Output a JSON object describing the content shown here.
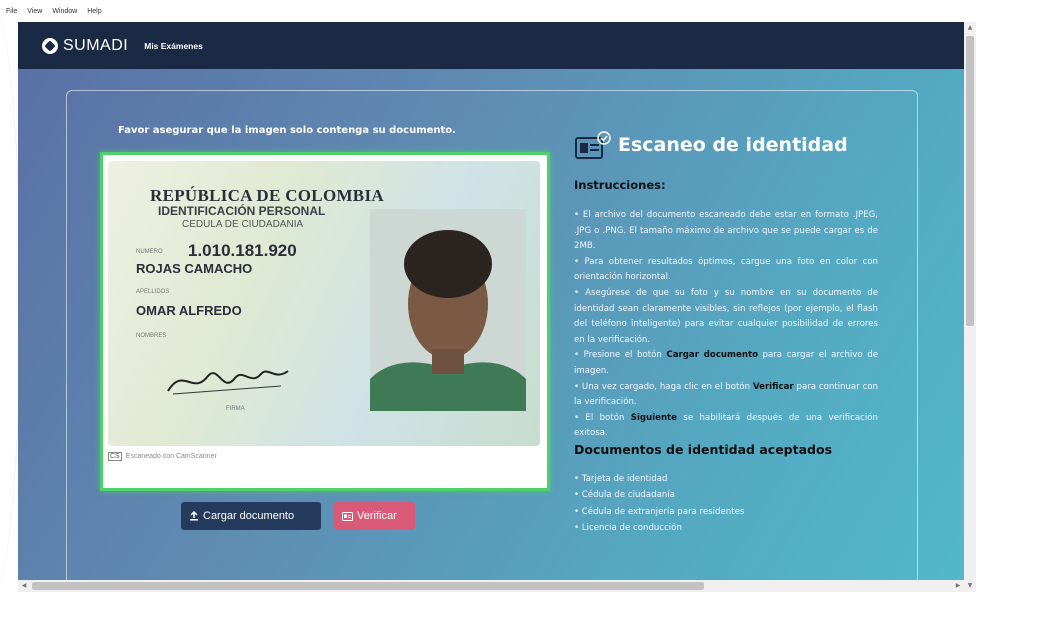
{
  "menubar": {
    "items": [
      "File",
      "View",
      "Window",
      "Help"
    ]
  },
  "nav": {
    "brand": "SUMADI",
    "link": "Mis Exámenes"
  },
  "warning": "Favor asegurar que la imagen solo contenga su documento.",
  "document": {
    "country": "REPÚBLICA DE COLOMBIA",
    "type": "IDENTIFICACIÓN PERSONAL",
    "subtype": "CEDULA DE CIUDADANIA",
    "number_label": "NUMERO",
    "number": "1.010.181.920",
    "surname": "ROJAS CAMACHO",
    "surname_label": "APELLIDOS",
    "given_names": "OMAR ALFREDO",
    "names_label": "NOMBRES",
    "signature_label": "FIRMA",
    "scanner_badge": "CS",
    "scanner_text": "Escaneado con CamScanner"
  },
  "buttons": {
    "upload": "Cargar documento",
    "verify": "Verificar"
  },
  "right": {
    "title": "Escaneo de identidad",
    "instructions_heading": "Instrucciones:",
    "instructions": [
      {
        "text": "• El archivo del documento escaneado debe estar en formato .JPEG, .JPG o .PNG. El tamaño máximo de archivo que se puede cargar es de 2MB."
      },
      {
        "text": "• Para obtener resultados óptimos, cargue una foto en color con orientación horizontal."
      },
      {
        "text": "• Asegúrese de que su foto y su nombre en su documento de identidad sean claramente visibles, sin reflejos (por ejemplo, el flash del teléfono inteligente) para evitar cualquier posibilidad de errores en la verificación."
      },
      {
        "pre": "• Presione el botón ",
        "bold": "Cargar documento",
        "post": " para cargar el archivo de imagen."
      },
      {
        "pre": "• Una vez cargado, haga clic en el botón ",
        "bold": "Verificar",
        "post": " para continuar con la verificación."
      },
      {
        "pre": "• El botón ",
        "bold": "Siguiente",
        "post": " se habilitará después de una verificación exitosa."
      }
    ],
    "docs_heading": "Documentos de identidad aceptados",
    "docs": [
      "• Tarjeta de identidad",
      "• Cédula de ciudadanía",
      "• Cédula de extranjería para residentes",
      "• Licencia de conducción"
    ]
  },
  "colors": {
    "nav_bg": "#1a2a44",
    "upload_btn": "#243b5e",
    "verify_btn": "#d85a78",
    "frame_green": "#4fd16a"
  }
}
